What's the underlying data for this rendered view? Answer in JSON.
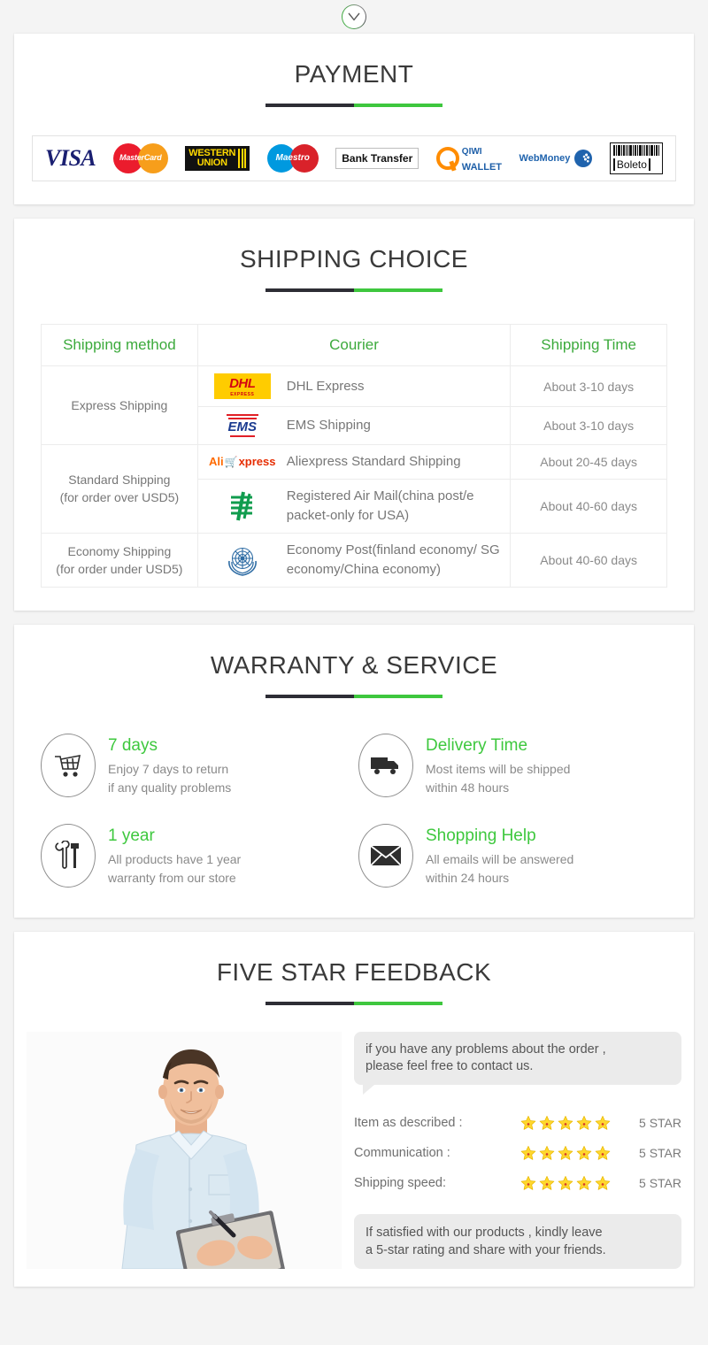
{
  "top_badge": {
    "icon": "chevron-down-icon"
  },
  "payment": {
    "title": "PAYMENT",
    "logos": [
      {
        "name": "visa-logo",
        "label": "VISA"
      },
      {
        "name": "mastercard-logo",
        "label": "MasterCard"
      },
      {
        "name": "western-union-logo",
        "label_line1": "WESTERN",
        "label_line2": "UNION"
      },
      {
        "name": "maestro-logo",
        "label": "Maestro"
      },
      {
        "name": "bank-transfer-logo",
        "label": "Bank Transfer"
      },
      {
        "name": "qiwi-wallet-logo",
        "label_line1": "QIWI",
        "label_line2": "WALLET"
      },
      {
        "name": "webmoney-logo",
        "label": "WebMoney"
      },
      {
        "name": "boleto-logo",
        "label": "Boleto"
      }
    ]
  },
  "shipping": {
    "title": "SHIPPING CHOICE",
    "headers": {
      "method": "Shipping method",
      "courier": "Courier",
      "time": "Shipping Time"
    },
    "groups": [
      {
        "method": "Express Shipping",
        "method_note": "",
        "rows": [
          {
            "logo": "dhl-logo",
            "courier": "DHL Express",
            "time": "About 3-10 days"
          },
          {
            "logo": "ems-logo",
            "courier": "EMS Shipping",
            "time": "About 3-10 days"
          }
        ]
      },
      {
        "method": "Standard Shipping",
        "method_note": "(for order over USD5)",
        "rows": [
          {
            "logo": "aliexpress-logo",
            "courier": "Aliexpress Standard Shipping",
            "time": "About 20-45 days"
          },
          {
            "logo": "china-post-logo",
            "courier": "Registered Air Mail(china post/e packet-only for USA)",
            "time": "About 40-60 days"
          }
        ]
      },
      {
        "method": "Economy Shipping",
        "method_note": "(for order under USD5)",
        "rows": [
          {
            "logo": "un-logo",
            "courier": "Economy Post(finland economy/ SG economy/China economy)",
            "time": "About 40-60 days"
          }
        ]
      }
    ]
  },
  "warranty": {
    "title": "WARRANTY & SERVICE",
    "items": [
      {
        "icon": "shopping-cart-icon",
        "heading": "7 days",
        "line1": "Enjoy 7 days to return",
        "line2": "if any quality problems"
      },
      {
        "icon": "delivery-truck-icon",
        "heading": "Delivery Time",
        "line1": "Most items will be shipped",
        "line2": "within 48 hours"
      },
      {
        "icon": "tools-icon",
        "heading": "1 year",
        "line1": "All products have 1 year",
        "line2": "warranty from our store"
      },
      {
        "icon": "envelope-icon",
        "heading": "Shopping Help",
        "line1": "All emails will be answered",
        "line2": "within 24 hours"
      }
    ]
  },
  "feedback": {
    "title": "FIVE STAR FEEDBACK",
    "photo_alt": "smiling-man-with-clipboard-photo",
    "bubble_line1": "if you have any problems about the order ,",
    "bubble_line2": "please feel free to contact us.",
    "ratings": [
      {
        "label": "Item as described :",
        "stars": 5,
        "value": "5 STAR"
      },
      {
        "label": "Communication :",
        "stars": 5,
        "value": "5 STAR"
      },
      {
        "label": "Shipping speed:",
        "stars": 5,
        "value": "5 STAR"
      }
    ],
    "footer_line1": "If satisfied with our products ,  kindly leave",
    "footer_line2": "a 5-star rating and share with your friends."
  },
  "colors": {
    "green": "#3ec73e",
    "dark": "#2d2d35",
    "header_green": "#3caa3c",
    "text_gray": "#8a8a8a",
    "page_bg": "#f4f4f4"
  }
}
